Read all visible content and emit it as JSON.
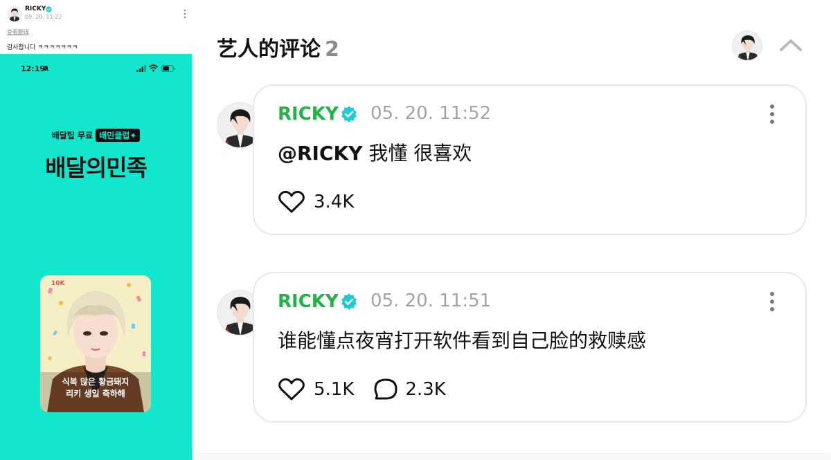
{
  "post": {
    "author": "RICKY",
    "time": "05. 20. 11:22",
    "translate_label": "查看翻译",
    "body": "감사합니다 ㅋㅋㅋㅋㅋㅋㅋ"
  },
  "phone": {
    "status_time": "12:19",
    "promo_text": "배달팁 무료",
    "promo_badge": "배민클럽✦",
    "app_name": "배달의민족",
    "card_line1": "식복 많은 황금돼지",
    "card_line2": "리키 생일 축하해"
  },
  "comments_section": {
    "title": "艺人的评论",
    "count": "2"
  },
  "comments": [
    {
      "author": "RICKY",
      "time": "05. 20. 11:52",
      "mention": "@RICKY",
      "text": " 我懂  很喜欢",
      "likes": "3.4K"
    },
    {
      "author": "RICKY",
      "time": "05. 20. 11:51",
      "text": "谁能懂点夜宵打开软件看到自己脸的救赎感",
      "likes": "5.1K",
      "replies": "2.3K"
    }
  ],
  "colors": {
    "phone_bg": "#12e6cd",
    "author_green": "#21b24a",
    "verified_blue": "#1ecad3"
  }
}
